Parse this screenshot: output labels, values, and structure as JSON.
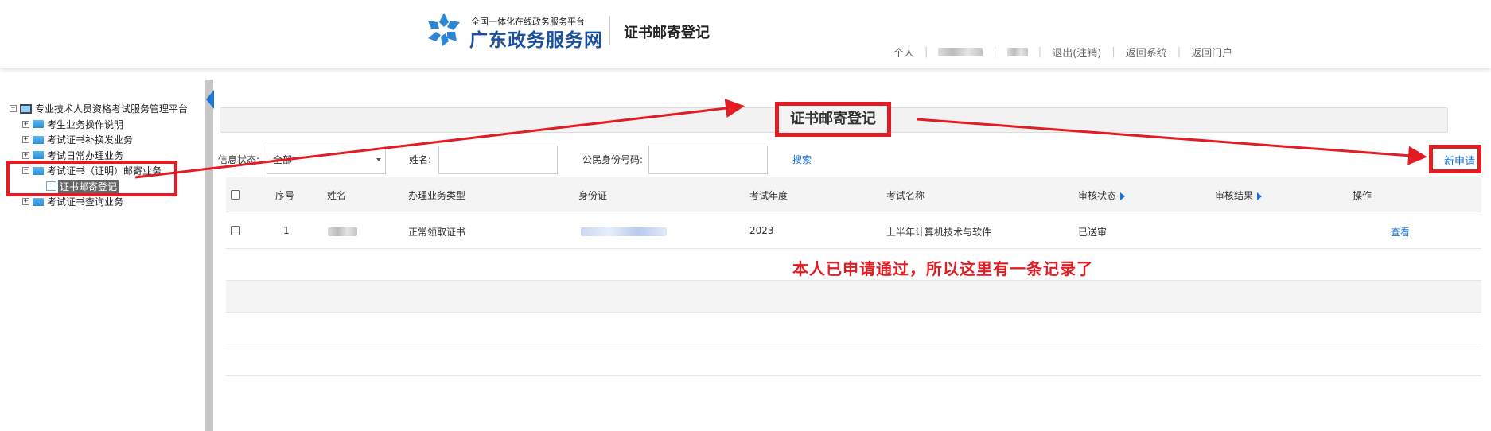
{
  "header": {
    "platform_small": "全国一体化在线政务服务平台",
    "platform_big": "广东政务服务网",
    "page_heading": "证书邮寄登记",
    "nav": [
      "个人",
      "退出(注销)",
      "返回系统",
      "返回门户"
    ]
  },
  "sidebar": {
    "root": "专业技术人员资格考试服务管理平台",
    "items": [
      {
        "label": "考生业务操作说明"
      },
      {
        "label": "考试证书补换发业务"
      },
      {
        "label": "考试日常办理业务"
      },
      {
        "label": "考试证书（证明）邮寄业务"
      },
      {
        "label": "证书邮寄登记"
      },
      {
        "label": "考试证书查询业务"
      }
    ]
  },
  "main": {
    "title": "证书邮寄登记",
    "filters": {
      "status_label": "信息状态:",
      "status_value": "全部",
      "name_label": "姓名:",
      "id_label": "公民身份号码:",
      "search": "搜索",
      "new_request": "新申请"
    },
    "table": {
      "headers": [
        "序号",
        "姓名",
        "办理业务类型",
        "身份证",
        "考试年度",
        "考试名称",
        "审核状态",
        "审核结果",
        "操作"
      ],
      "rows": [
        {
          "index": "1",
          "business_type": "正常领取证书",
          "year": "2023",
          "exam_name": "上半年计算机技术与软件",
          "status": "已送审",
          "result": "",
          "action": "查看"
        }
      ]
    },
    "annotation": "本人已申请通过，所以这里有一条记录了"
  },
  "colors": {
    "accent_blue": "#1a73d6",
    "annotation_red": "#e31b23",
    "brand_blue": "#1a4f9e"
  }
}
